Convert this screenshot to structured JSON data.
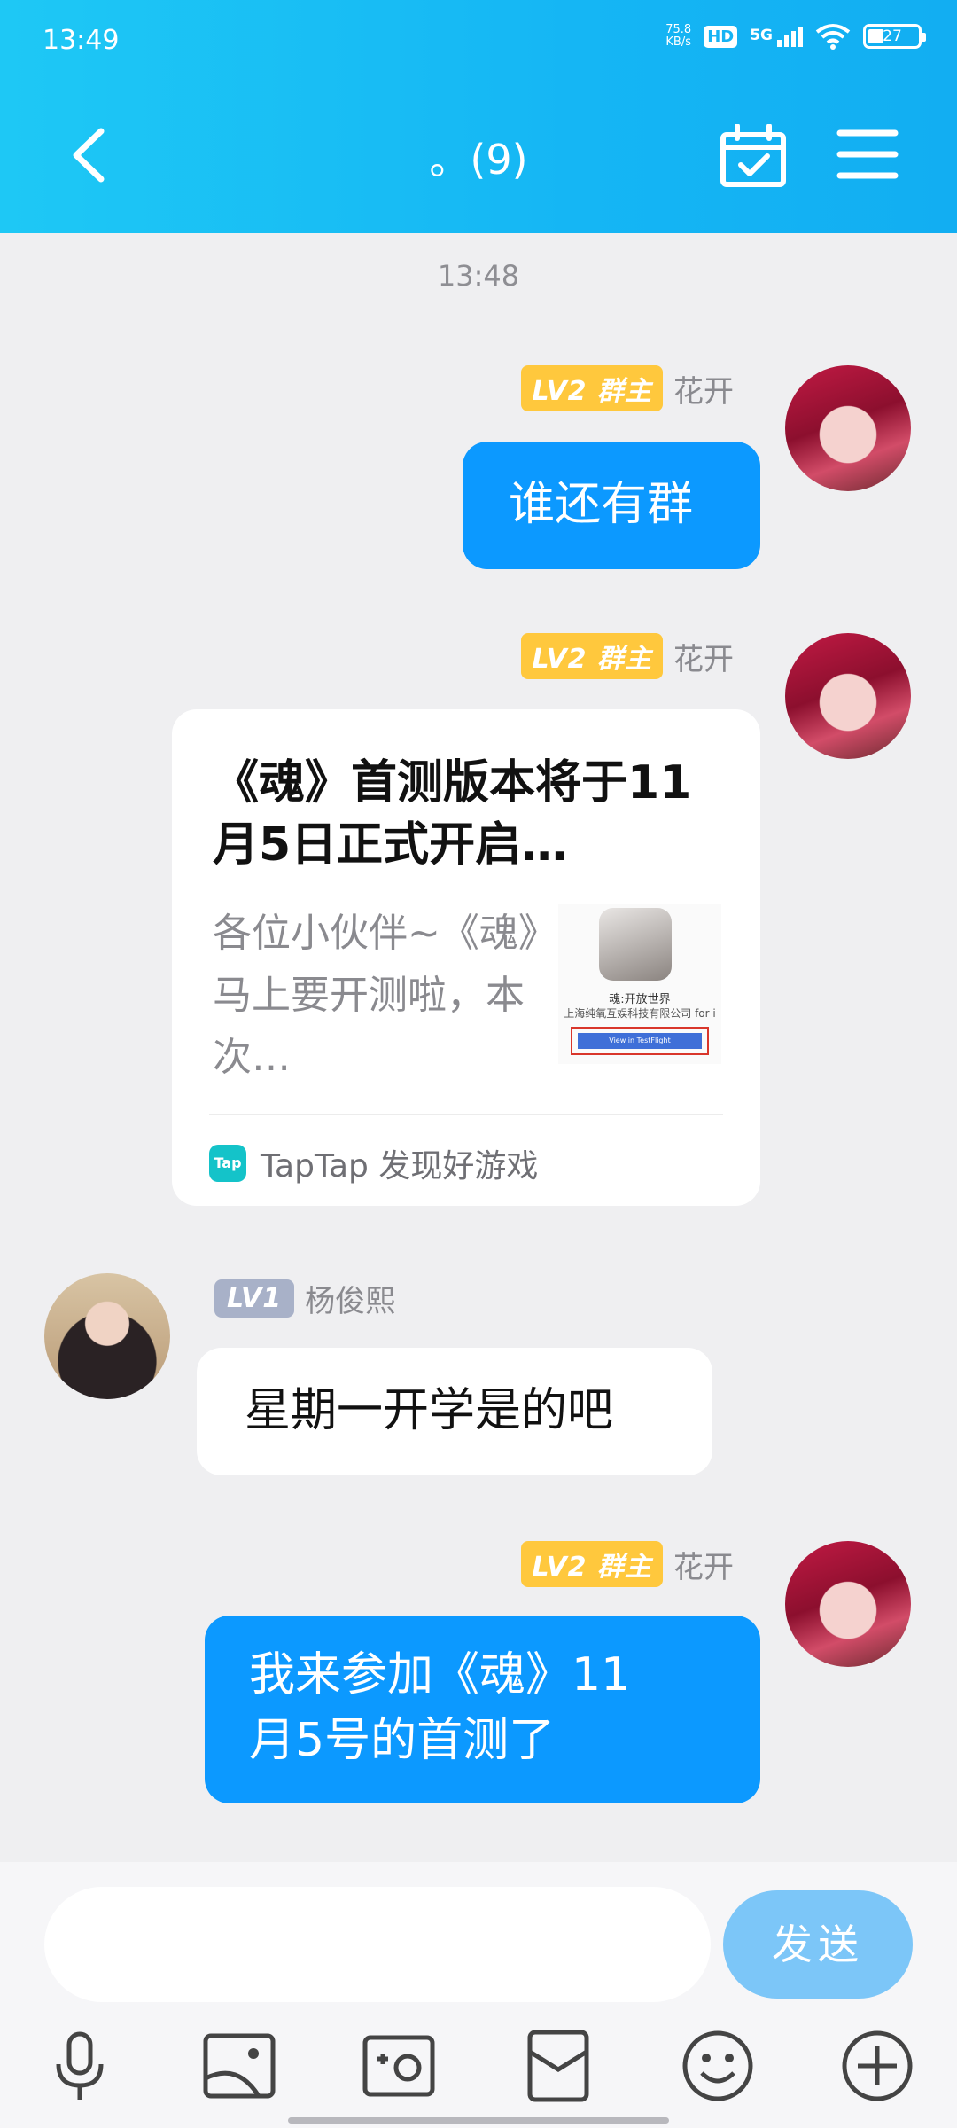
{
  "status_bar": {
    "time": "13:49",
    "net_speed_value": "75.8",
    "net_speed_unit": "KB/s",
    "hd": "HD",
    "signal": "5G",
    "battery": "27"
  },
  "header": {
    "title": "。(9)",
    "back_icon": "chevron-left-icon",
    "calendar_icon": "calendar-check-icon",
    "menu_icon": "menu-icon"
  },
  "chat": {
    "timestamp": "13:48",
    "messages": [
      {
        "badge": "LV2 群主",
        "sender": "花开",
        "text": "谁还有群"
      },
      {
        "badge": "LV2 群主",
        "sender": "花开",
        "card": {
          "title": "《魂》首测版本将于11月5日正式开启…",
          "description": "各位小伙伴~《魂》马上要开测啦，本次…",
          "thumb_app_name": "魂:开放世界",
          "thumb_developer": "上海纯氧互娱科技有限公司 for i",
          "thumb_button": "View in TestFlight",
          "source_logo": "Tap",
          "source": "TapTap 发现好游戏"
        }
      },
      {
        "badge": "LV1",
        "sender": "杨俊熙",
        "text": "星期一开学是的吧"
      },
      {
        "badge": "LV2 群主",
        "sender": "花开",
        "text_line1": "我来参加《魂》11",
        "text_line2": "月5号的首测了"
      }
    ]
  },
  "input_bar": {
    "placeholder": "",
    "send_label": "发送",
    "tools": [
      "microphone-icon",
      "image-icon",
      "camera-icon",
      "red-packet-icon",
      "emoji-icon",
      "plus-icon"
    ]
  },
  "colors": {
    "header_blue": "#15b6f4",
    "bubble_blue": "#0c99ff",
    "host_badge": "#ffc83d",
    "lv1_badge": "#a8b1c8",
    "send_button": "#7cc6f8"
  }
}
